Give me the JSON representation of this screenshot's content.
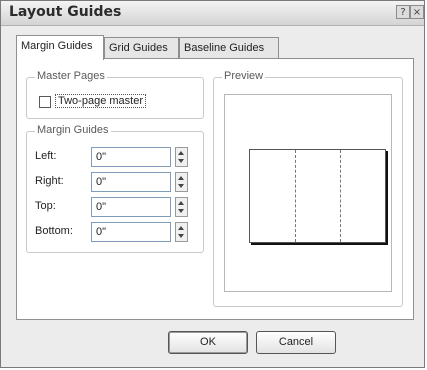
{
  "dialog": {
    "title": "Layout Guides",
    "help_glyph": "?",
    "close_glyph": "×"
  },
  "tabs": [
    {
      "label": "Margin Guides",
      "active": true
    },
    {
      "label": "Grid Guides",
      "active": false
    },
    {
      "label": "Baseline Guides",
      "active": false
    }
  ],
  "master_pages": {
    "legend": "Master Pages",
    "checkbox_label": "Two-page master",
    "checked": false
  },
  "margin_guides": {
    "legend": "Margin Guides",
    "fields": [
      {
        "label": "Left:",
        "value": "0\""
      },
      {
        "label": "Right:",
        "value": "0\""
      },
      {
        "label": "Top:",
        "value": "0\""
      },
      {
        "label": "Bottom:",
        "value": "0\""
      }
    ]
  },
  "preview": {
    "legend": "Preview"
  },
  "buttons": {
    "ok": "OK",
    "cancel": "Cancel"
  }
}
